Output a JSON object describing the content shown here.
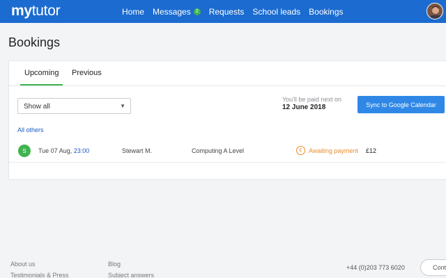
{
  "header": {
    "logo_bold": "my",
    "logo_light": "tutor",
    "nav": [
      {
        "label": "Home"
      },
      {
        "label": "Messages",
        "badge": "2"
      },
      {
        "label": "Requests"
      },
      {
        "label": "School leads"
      },
      {
        "label": "Bookings"
      }
    ],
    "accent_color": "#1b6bd0"
  },
  "page": {
    "title": "Bookings"
  },
  "tabs": [
    {
      "label": "Upcoming",
      "active": true
    },
    {
      "label": "Previous",
      "active": false
    }
  ],
  "filter": {
    "selected": "Show all"
  },
  "payment": {
    "label": "You'll be paid next on",
    "date": "12 June 2018"
  },
  "sync_button": "Sync to Google Calendar",
  "group_label": "All others",
  "bookings": [
    {
      "avatar_initial": "S",
      "day": "Tue 07 Aug,",
      "time": "23:00",
      "student": "Stewart M.",
      "subject": "Computing A Level",
      "status_symbol": "£",
      "status": "Awaiting payment",
      "amount": "£12"
    }
  ],
  "footer": {
    "links_col1": [
      "About us",
      "Testimonials & Press"
    ],
    "links_col2": [
      "Blog",
      "Subject answers"
    ],
    "phone": "+44 (0)203 773 6020",
    "contact_partial": "Cont"
  }
}
